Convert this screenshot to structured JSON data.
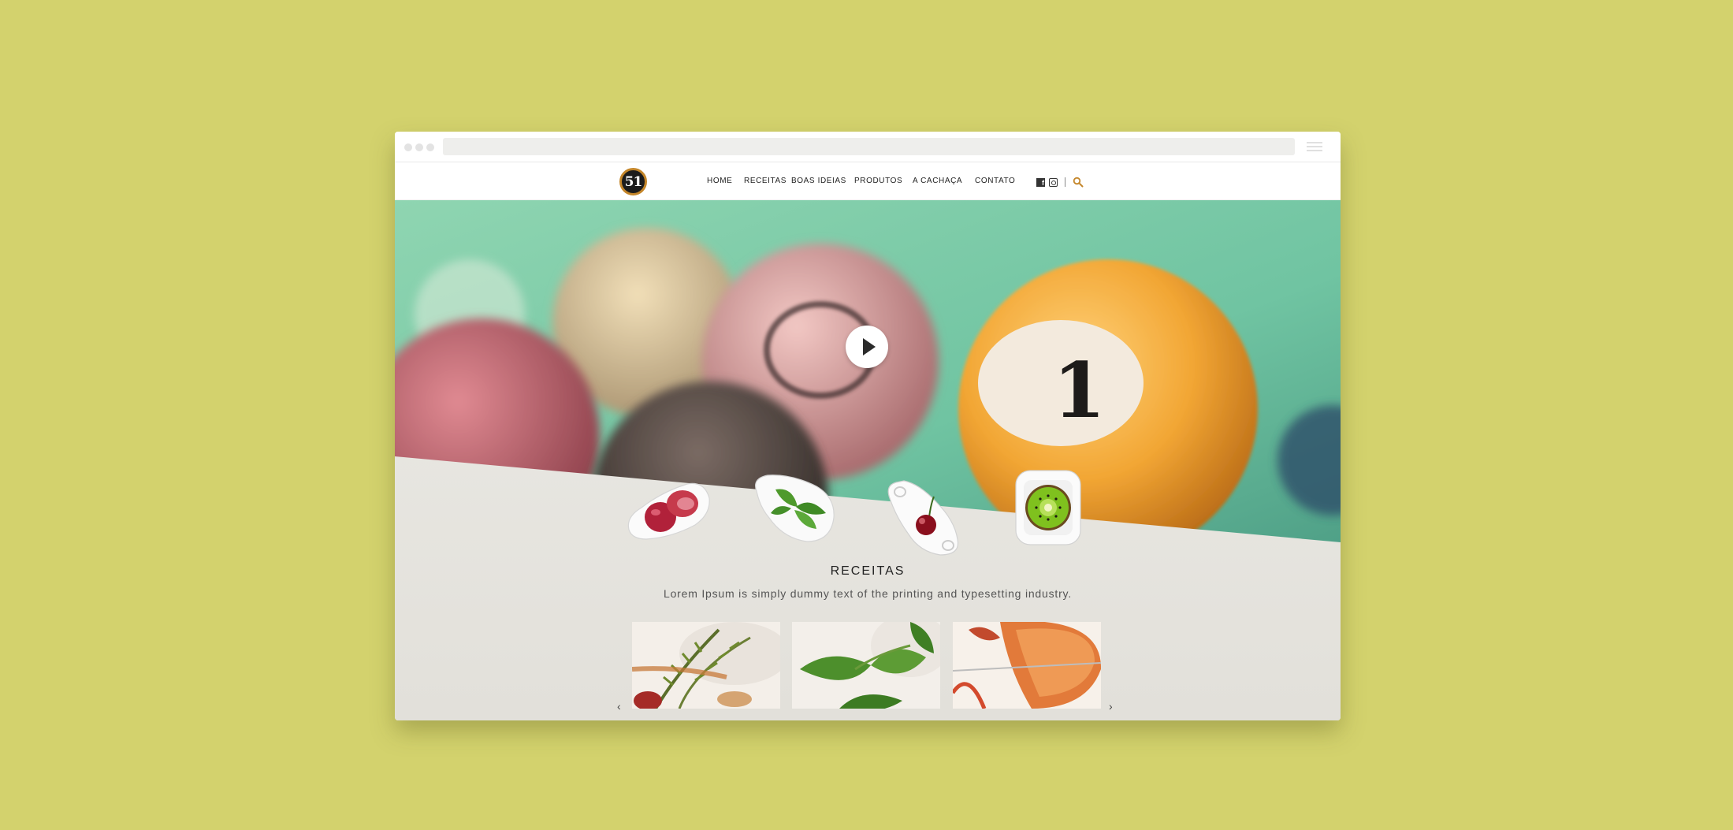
{
  "window": {
    "url_bar_value": ""
  },
  "site": {
    "logo_text": "51",
    "nav_items": [
      {
        "label": "HOME"
      },
      {
        "label": "RECEITAS"
      },
      {
        "label": "BOAS IDEIAS"
      },
      {
        "label": "PRODUTOS"
      },
      {
        "label": "A CACHAÇA"
      },
      {
        "label": "CONTATO"
      }
    ],
    "social_icons": [
      "facebook-icon",
      "instagram-icon"
    ],
    "search_icon": "search-icon",
    "accent_color": "#c4862a"
  },
  "hero": {
    "play_icon": "play-icon",
    "ball_number": "1",
    "background_color": "#6fc3a3"
  },
  "dishes": [
    {
      "name": "grapes-dish-icon"
    },
    {
      "name": "basil-dish-icon"
    },
    {
      "name": "cherry-dish-icon"
    },
    {
      "name": "kiwi-dish-icon"
    }
  ],
  "receitas": {
    "title": "RECEITAS",
    "subtitle": "Lorem Ipsum is simply dummy text of the printing and typesetting industry.",
    "cards": [
      {
        "name": "rosemary-drink"
      },
      {
        "name": "mint-drink"
      },
      {
        "name": "orange-drink"
      }
    ],
    "prev_arrow": "‹",
    "next_arrow": "›"
  }
}
